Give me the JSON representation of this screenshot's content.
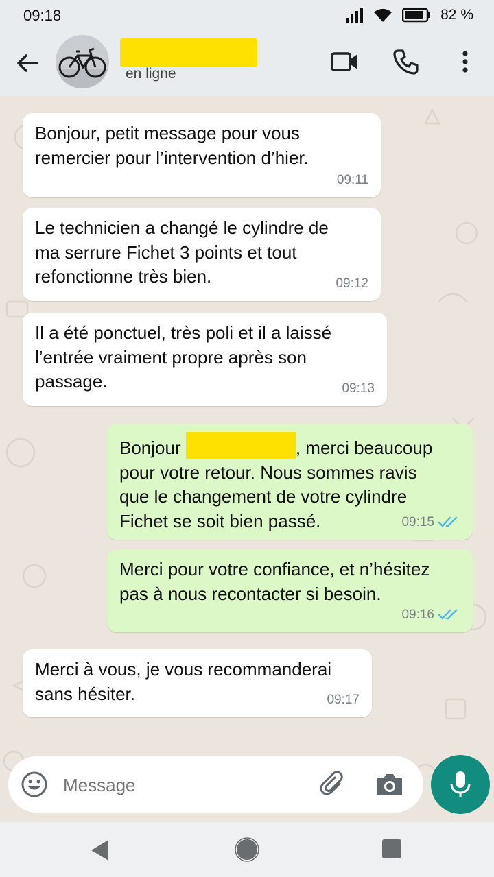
{
  "status_bar": {
    "time": "09:18",
    "battery": "82 %"
  },
  "header": {
    "contact_status": "en ligne",
    "icons": [
      "back-arrow-icon",
      "video-call-icon",
      "voice-call-icon",
      "more-options-icon"
    ]
  },
  "messages": [
    {
      "direction": "in",
      "text": "Bonjour, petit message pour vous\nremercier pour l’intervention d’hier.",
      "time": "09:11"
    },
    {
      "direction": "in",
      "text": "Le technicien a changé le cylindre de\nma serrure Fichet 3 points et tout\nrefonctionne très bien.",
      "time": "09:12"
    },
    {
      "direction": "in",
      "text": "Il a été ponctuel, très poli et il a laissé\nl’entrée vraiment propre après son\npassage.",
      "time": "09:13"
    },
    {
      "direction": "out",
      "text_before": "Bonjour ",
      "text_after": ", merci beaucoup",
      "text_rest": "pour votre retour. Nous sommes ravis\nque le changement de votre cylindre\nFichet se soit bien passé.",
      "time": "09:15",
      "read": true
    },
    {
      "direction": "out",
      "text": "Merci pour votre confiance, et n’hésitez\npas à nous recontacter si besoin.",
      "time": "09:16",
      "read": true
    },
    {
      "direction": "in",
      "text": "Merci à vous, je vous recommanderai\nsans hésiter.",
      "time": "09:17"
    }
  ],
  "composer": {
    "placeholder": "Message"
  },
  "colors": {
    "incoming_bubble": "#ffffff",
    "outgoing_bubble": "#dcf8c6",
    "read_ticks": "#4fb6ec",
    "mic_button": "#128c7e",
    "redaction": "#ffe100"
  }
}
